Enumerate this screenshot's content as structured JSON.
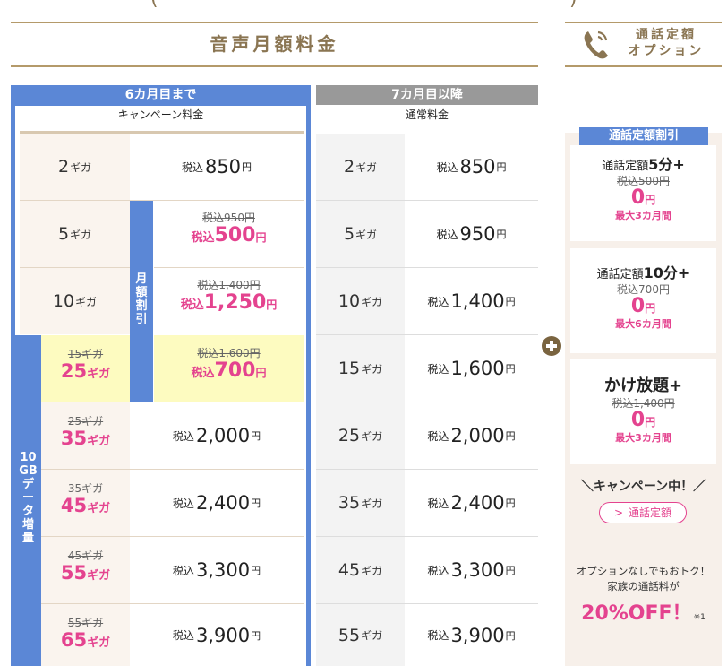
{
  "colors": {
    "accent_gold": "#8a7552",
    "campaign_blue": "#5b87d6",
    "normal_gray": "#999999",
    "pink": "#e4438f",
    "highlight_yellow": "#fdfbc0"
  },
  "header": {
    "left_paren": "(",
    "right_paren": ")",
    "title": "音声月額料金",
    "option_title_line1": "通話定額",
    "option_title_line2": "オプション"
  },
  "campaign": {
    "header": "6カ月目まで",
    "subheader": "キャンペーン料金",
    "monthly_discount_label": [
      "月",
      "額",
      "割",
      "引"
    ],
    "data_increase_label": [
      "10",
      "GB",
      "デ",
      "ー",
      "タ",
      "増",
      "量"
    ]
  },
  "normal": {
    "header": "7カ月目以降",
    "subheader": "通常料金"
  },
  "unit": {
    "giga": "ギガ",
    "tax_prefix": "税込",
    "yen": "円"
  },
  "rows": [
    {
      "plan": "2",
      "normal_price": "850",
      "campaign_price": "850"
    },
    {
      "plan": "5",
      "normal_price": "950",
      "campaign_old": "税込950円",
      "campaign_price": "500"
    },
    {
      "plan": "10",
      "normal_price": "1,400",
      "campaign_old": "税込1,400円",
      "campaign_price": "1,250"
    },
    {
      "plan": "15",
      "boosted": "25",
      "normal_price": "1,600",
      "campaign_old": "税込1,600円",
      "campaign_price": "700",
      "old_giga": "15ギガ"
    },
    {
      "plan": "25",
      "boosted": "35",
      "normal_price": "2,000",
      "campaign_price": "2,000",
      "old_giga": "25ギガ"
    },
    {
      "plan": "35",
      "boosted": "45",
      "normal_price": "2,400",
      "campaign_price": "2,400",
      "old_giga": "35ギガ"
    },
    {
      "plan": "45",
      "boosted": "55",
      "normal_price": "3,300",
      "campaign_price": "3,300",
      "old_giga": "45ギガ"
    },
    {
      "plan": "55",
      "boosted": "65",
      "normal_price": "3,900",
      "campaign_price": "3,900",
      "old_giga": "55ギガ"
    }
  ],
  "options": {
    "discount_header": "通話定額割引",
    "items": [
      {
        "name_prefix": "通話定額",
        "name_bold": "5分+",
        "old": "税込500円",
        "new": "0",
        "yen": "円",
        "max": "最大3カ月間"
      },
      {
        "name_prefix": "通話定額",
        "name_bold": "10分+",
        "old": "税込700円",
        "new": "0",
        "yen": "円",
        "max": "最大6カ月間"
      },
      {
        "name_prefix": "",
        "name_bold": "かけ放題+",
        "old": "税込1,400円",
        "new": "0",
        "yen": "円",
        "max": "最大3カ月間"
      }
    ],
    "campaign_note": "＼キャンペーン中！／",
    "link_label": "通話定額",
    "no_option_line1": "オプションなしでもおトク！",
    "no_option_line2": "家族の通話料が",
    "off_text": "20%OFF！",
    "footnote": "※1"
  }
}
